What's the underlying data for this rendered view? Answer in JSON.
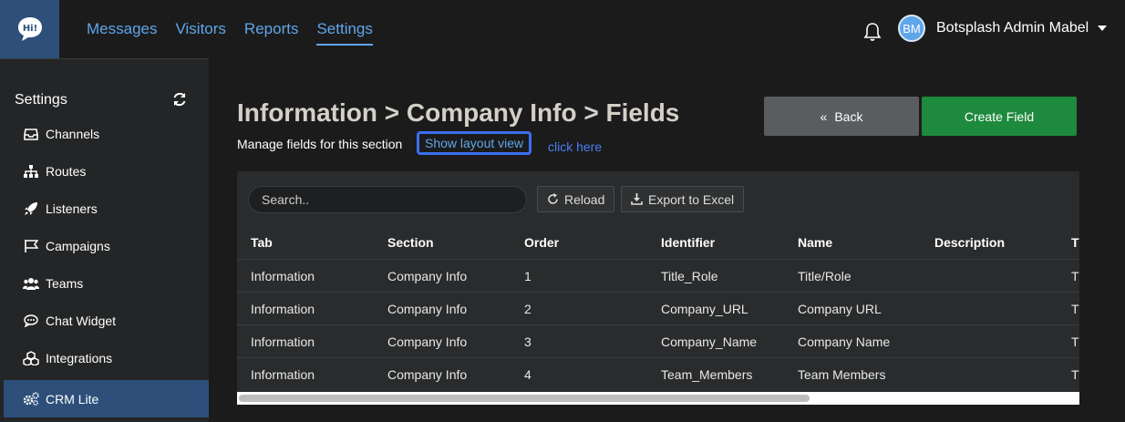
{
  "header": {
    "logo_text": "Hi!",
    "nav": [
      {
        "label": "Messages"
      },
      {
        "label": "Visitors"
      },
      {
        "label": "Reports"
      },
      {
        "label": "Settings",
        "active": true
      }
    ],
    "user": {
      "initials": "BM",
      "name": "Botsplash Admin Mabel"
    }
  },
  "sidebar": {
    "title": "Settings",
    "items": [
      {
        "label": "Channels",
        "icon": "inbox-icon"
      },
      {
        "label": "Routes",
        "icon": "sitemap-icon"
      },
      {
        "label": "Listeners",
        "icon": "rocket-icon"
      },
      {
        "label": "Campaigns",
        "icon": "flag-icon"
      },
      {
        "label": "Teams",
        "icon": "users-icon"
      },
      {
        "label": "Chat Widget",
        "icon": "chat-icon"
      },
      {
        "label": "Integrations",
        "icon": "cubes-icon"
      },
      {
        "label": "CRM Lite",
        "icon": "gears-icon",
        "active": true
      }
    ]
  },
  "page": {
    "title": "Information > Company Info > Fields",
    "subtitle": "Manage fields for this section",
    "layout_link": "Show layout view",
    "click_here": "click here",
    "back_label": "Back",
    "create_label": "Create Field"
  },
  "toolbar": {
    "search_placeholder": "Search..",
    "reload_label": "Reload",
    "export_label": "Export to Excel"
  },
  "table": {
    "columns": [
      "Tab",
      "Section",
      "Order",
      "Identifier",
      "Name",
      "Description",
      "T"
    ],
    "rows": [
      [
        "Information",
        "Company Info",
        "1",
        "Title_Role",
        "Title/Role",
        "",
        "T"
      ],
      [
        "Information",
        "Company Info",
        "2",
        "Company_URL",
        "Company URL",
        "",
        "T"
      ],
      [
        "Information",
        "Company Info",
        "3",
        "Company_Name",
        "Company Name",
        "",
        "T"
      ],
      [
        "Information",
        "Company Info",
        "4",
        "Team_Members",
        "Team Members",
        "",
        "T"
      ]
    ]
  },
  "colors": {
    "accent": "#5fa6e8",
    "create_button": "#1e8a3e",
    "back_button": "#5a5d60",
    "sidebar_active": "#2d4f7a"
  }
}
